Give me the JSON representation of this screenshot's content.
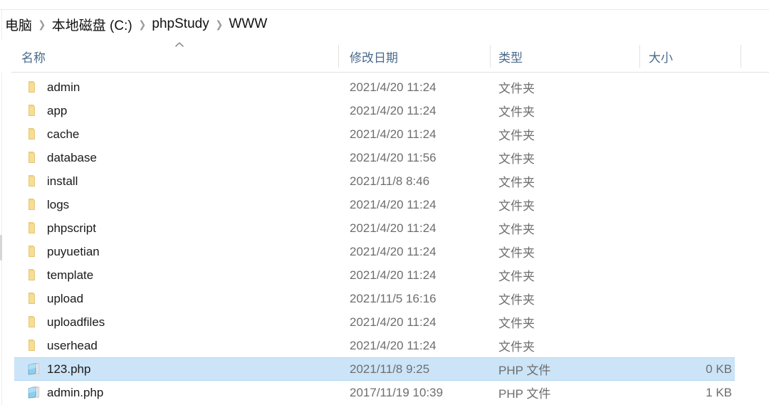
{
  "window": {
    "title": "WWW"
  },
  "breadcrumb": {
    "separator": "❯",
    "items": [
      {
        "label": "电脑"
      },
      {
        "label": "本地磁盘 (C:)"
      },
      {
        "label": "phpStudy"
      },
      {
        "label": "WWW"
      }
    ]
  },
  "columns": {
    "sort_indicator": "^",
    "sort_column": "name",
    "sort_direction": "ascending",
    "headers": [
      {
        "key": "name",
        "label": "名称"
      },
      {
        "key": "date",
        "label": "修改日期"
      },
      {
        "key": "type",
        "label": "类型"
      },
      {
        "key": "size",
        "label": "大小"
      }
    ]
  },
  "colors": {
    "selection": "#cce4f7",
    "selection_border": "#b3d7f2",
    "header_text": "#4a6a8a",
    "folder_icon": "#f5d98a",
    "php_icon": "#6fb8e0"
  },
  "files": [
    {
      "name": "admin",
      "date": "2021/4/20 11:24",
      "type": "文件夹",
      "size": "",
      "icon": "folder-icon",
      "selected": false
    },
    {
      "name": "app",
      "date": "2021/4/20 11:24",
      "type": "文件夹",
      "size": "",
      "icon": "folder-icon",
      "selected": false
    },
    {
      "name": "cache",
      "date": "2021/4/20 11:24",
      "type": "文件夹",
      "size": "",
      "icon": "folder-icon",
      "selected": false
    },
    {
      "name": "database",
      "date": "2021/4/20 11:56",
      "type": "文件夹",
      "size": "",
      "icon": "folder-icon",
      "selected": false
    },
    {
      "name": "install",
      "date": "2021/11/8 8:46",
      "type": "文件夹",
      "size": "",
      "icon": "folder-icon",
      "selected": false
    },
    {
      "name": "logs",
      "date": "2021/4/20 11:24",
      "type": "文件夹",
      "size": "",
      "icon": "folder-icon",
      "selected": false
    },
    {
      "name": "phpscript",
      "date": "2021/4/20 11:24",
      "type": "文件夹",
      "size": "",
      "icon": "folder-icon",
      "selected": false
    },
    {
      "name": "puyuetian",
      "date": "2021/4/20 11:24",
      "type": "文件夹",
      "size": "",
      "icon": "folder-icon",
      "selected": false
    },
    {
      "name": "template",
      "date": "2021/4/20 11:24",
      "type": "文件夹",
      "size": "",
      "icon": "folder-icon",
      "selected": false
    },
    {
      "name": "upload",
      "date": "2021/11/5 16:16",
      "type": "文件夹",
      "size": "",
      "icon": "folder-icon",
      "selected": false
    },
    {
      "name": "uploadfiles",
      "date": "2021/4/20 11:24",
      "type": "文件夹",
      "size": "",
      "icon": "folder-icon",
      "selected": false
    },
    {
      "name": "userhead",
      "date": "2021/4/20 11:24",
      "type": "文件夹",
      "size": "",
      "icon": "folder-icon",
      "selected": false
    },
    {
      "name": "123.php",
      "date": "2021/11/8 9:25",
      "type": "PHP 文件",
      "size": "0 KB",
      "icon": "php-file-icon",
      "selected": true
    },
    {
      "name": "admin.php",
      "date": "2017/11/19 10:39",
      "type": "PHP 文件",
      "size": "1 KB",
      "icon": "php-file-icon",
      "selected": false
    }
  ]
}
